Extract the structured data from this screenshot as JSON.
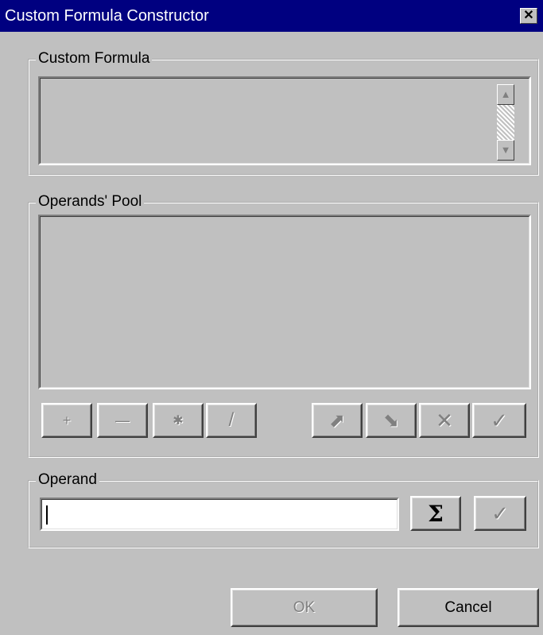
{
  "window": {
    "title": "Custom Formula Constructor",
    "close_glyph": "✕"
  },
  "custom_formula": {
    "label": "Custom Formula",
    "value": "",
    "scroll_up": "▲",
    "scroll_down": "▼"
  },
  "operands_pool": {
    "label": "Operands' Pool",
    "op_buttons": [
      {
        "symbol": "+"
      },
      {
        "symbol": "—"
      },
      {
        "symbol": "✱"
      },
      {
        "symbol": "/"
      }
    ],
    "action_buttons": [
      {
        "symbol": "⬈",
        "icon": "arrow-up-right-icon"
      },
      {
        "symbol": "⬊",
        "icon": "arrow-down-right-icon"
      },
      {
        "symbol": "✕",
        "icon": "delete-icon"
      },
      {
        "symbol": "✓",
        "icon": "check-icon"
      }
    ]
  },
  "operand": {
    "label": "Operand",
    "value": "",
    "sum_symbol": "Σ",
    "check_symbol": "✓"
  },
  "footer": {
    "ok_label": "OK",
    "cancel_label": "Cancel"
  },
  "colors": {
    "face": "#c0c0c0",
    "titlebar": "#000080",
    "disabled_text": "#808080"
  }
}
